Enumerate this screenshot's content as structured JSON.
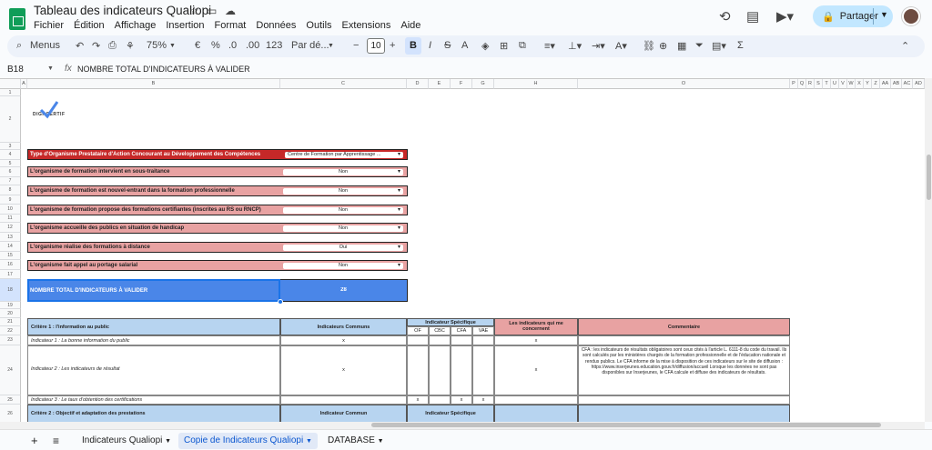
{
  "title": "Tableau des indicateurs Qualiopi",
  "menu": [
    "Fichier",
    "Édition",
    "Affichage",
    "Insertion",
    "Format",
    "Données",
    "Outils",
    "Extensions",
    "Aide"
  ],
  "share_label": "Partager",
  "toolbar": {
    "menus_label": "Menus",
    "zoom": "75%",
    "currency": "€",
    "percent": "%",
    "dec_less": ".0",
    "dec_more": ".00",
    "number_fmt": "123",
    "font": "Par dé...",
    "font_size": "10",
    "bold": "B",
    "italic": "I",
    "strike": "S",
    "text_color": "A",
    "sigma": "Σ"
  },
  "formula_bar": {
    "cell_ref": "B18",
    "fx": "fx",
    "content": "NOMBRE TOTAL D'INDICATEURS À VALIDER"
  },
  "columns": [
    "A",
    "B",
    "C",
    "D",
    "E",
    "F",
    "G",
    "H",
    "",
    "O",
    "P",
    "Q",
    "R",
    "S",
    "T",
    "U",
    "V",
    "W",
    "X",
    "Y",
    "Z",
    "AA",
    "AB",
    "AC",
    "AD"
  ],
  "rows": [
    "1",
    "2",
    "3",
    "4",
    "5",
    "6",
    "7",
    "8",
    "9",
    "10",
    "11",
    "12",
    "13",
    "14",
    "15",
    "16",
    "17",
    "18",
    "19",
    "20",
    "21",
    "22",
    "23",
    "24",
    "25",
    "26"
  ],
  "logo_text": "DIGI·CERTIF",
  "questions": [
    {
      "label": "Type d'Organisme Prestataire d'Action Concourant au Développement des Compétences",
      "value": "Centre de Formation par Apprentissage ..."
    },
    {
      "label": "L'organisme de formation intervient en sous-traitance",
      "value": "Non"
    },
    {
      "label": "L'organisme de formation est nouvel-entrant dans la formation professionnelle",
      "value": "Non"
    },
    {
      "label": "L'organisme de formation propose des formations certifiantes (inscrites au RS ou RNCP)",
      "value": "Non"
    },
    {
      "label": "L'organisme accueille des publics en situation de handicap",
      "value": "Non"
    },
    {
      "label": "L'organisme réalise des formations à distance",
      "value": "Oui"
    },
    {
      "label": "L'organisme fait appel au portage salarial",
      "value": "Non"
    }
  ],
  "total": {
    "label": "NOMBRE TOTAL D'INDICATEURS À VALIDER",
    "value": "28"
  },
  "table": {
    "criterion1": "Critère 1 : l'information au public",
    "common": "Indicateurs Communs",
    "specific": "Indicateur Spécifique",
    "sub": [
      "OF",
      "CBC",
      "CFA",
      "VAE"
    ],
    "concern": "Les indicateurs qui me concernent",
    "comment": "Commentaire",
    "ind1": "Indicateur 1 : La bonne information du public",
    "ind2": "Indicateur 2 : Les indicateurs de résultat",
    "ind3": "Indicateur 3 : Le taux d'obtention des certifications",
    "x": "x",
    "comment2": "CFA : les indicateurs de résultats obligatoires sont ceux cités à l'article L. 6111-8 du code du travail. Ils sont calculés par les ministères chargés de la formation professionnelle et de l'éducation nationale et rendus publics. Le CFA informe de la mise à disposition de ces indicateurs sur le site de diffusion : https://www.inserjeunes.education.gouv.fr/diffusion/accueil Lorsque les données ne sont pas disponibles sur Inserjeunes, le CFA calcule et diffuse des indicateurs de résultats.",
    "criterion2": "Critère 2 : Objectif et adaptation des prestations",
    "common2": "Indicateur Commun",
    "specific2": "Indicateur Spécifique"
  },
  "tabs": [
    "Indicateurs Qualiopi",
    "Copie de Indicateurs Qualiopi",
    "DATABASE"
  ],
  "colors": {
    "red": "#c62828",
    "pink": "#e8a2a2",
    "blue": "#4a86e8",
    "header_blue": "#b7d4f0",
    "share": "#c2e7ff"
  }
}
